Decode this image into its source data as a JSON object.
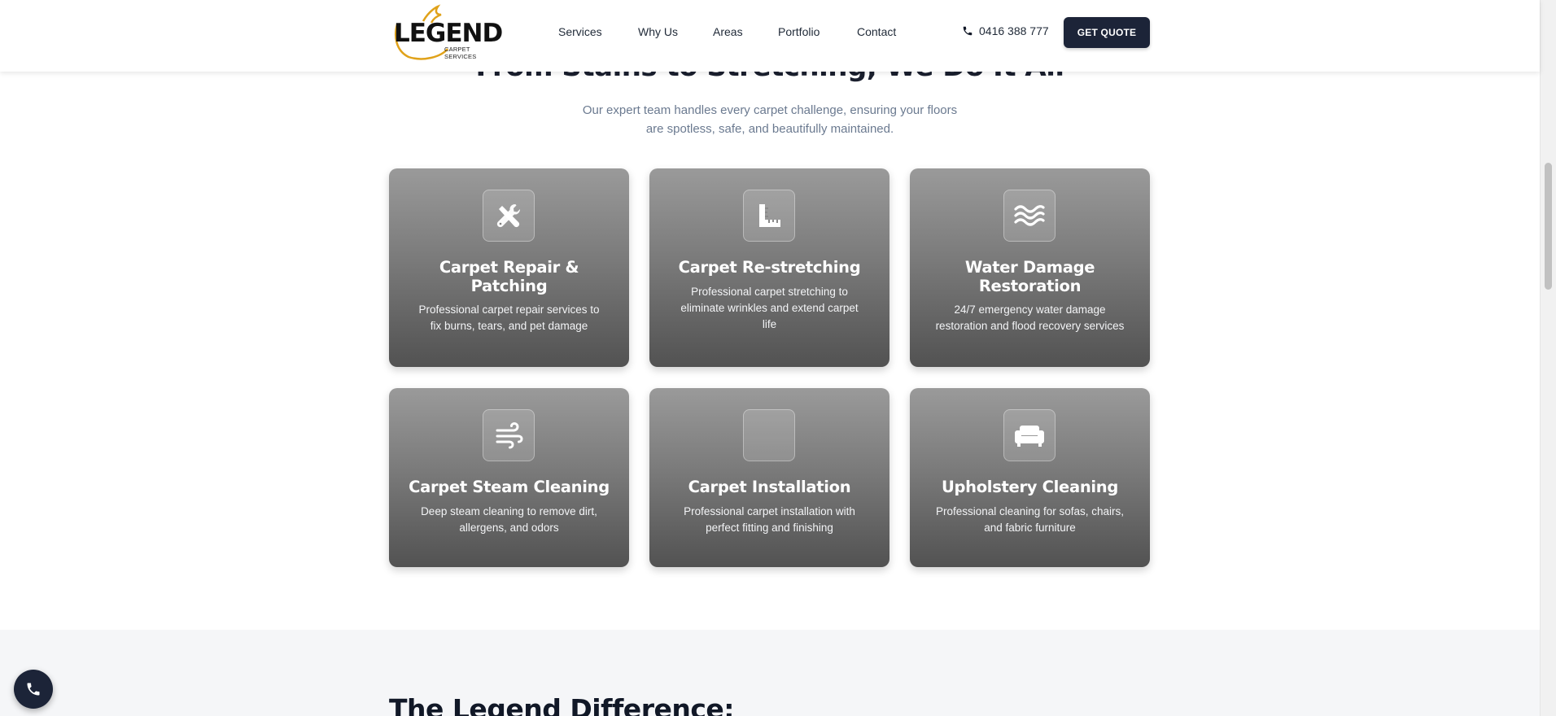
{
  "header": {
    "logo_text": "LEGEND",
    "logo_subtext": "CARPET SERVICES",
    "nav": [
      {
        "label": "Services"
      },
      {
        "label": "Why Us"
      },
      {
        "label": "Areas"
      },
      {
        "label": "Portfolio"
      },
      {
        "label": "Contact"
      }
    ],
    "phone": "0416 388 777",
    "quote_button": "GET QUOTE"
  },
  "section": {
    "title": "From Stains to Stretching, We Do It All",
    "subtitle_line1": "Our expert team handles every carpet challenge, ensuring your floors",
    "subtitle_line2": "are spotless, safe, and beautifully maintained."
  },
  "services": [
    {
      "icon": "tools-icon",
      "title_line1": "Carpet Repair &",
      "title_line2": "Patching",
      "desc_line1": "Professional carpet repair services to",
      "desc_line2": "fix burns, tears, and pet damage",
      "desc_line3": ""
    },
    {
      "icon": "ruler-icon",
      "title_line1": "Carpet Re-stretching",
      "title_line2": "",
      "desc_line1": "Professional carpet stretching to",
      "desc_line2": "eliminate wrinkles and extend carpet",
      "desc_line3": "life"
    },
    {
      "icon": "water-icon",
      "title_line1": "Water Damage",
      "title_line2": "Restoration",
      "desc_line1": "24/7 emergency water damage",
      "desc_line2": "restoration and flood recovery services",
      "desc_line3": ""
    },
    {
      "icon": "wind-icon",
      "title_line1": "Carpet Steam Cleaning",
      "title_line2": "",
      "desc_line1": "Deep steam cleaning to remove dirt,",
      "desc_line2": "allergens, and odors",
      "desc_line3": ""
    },
    {
      "icon": "",
      "title_line1": "Carpet Installation",
      "title_line2": "",
      "desc_line1": "Professional carpet installation with",
      "desc_line2": "perfect fitting and finishing",
      "desc_line3": ""
    },
    {
      "icon": "couch-icon",
      "title_line1": "Upholstery Cleaning",
      "title_line2": "",
      "desc_line1": "Professional cleaning for sofas, chairs,",
      "desc_line2": "and fabric furniture",
      "desc_line3": ""
    }
  ],
  "lower_section": {
    "title": "The Legend Difference:"
  },
  "colors": {
    "accent": "#1c2438",
    "logo_gold": "#e0a21a",
    "subtitle": "#6b7a90"
  }
}
